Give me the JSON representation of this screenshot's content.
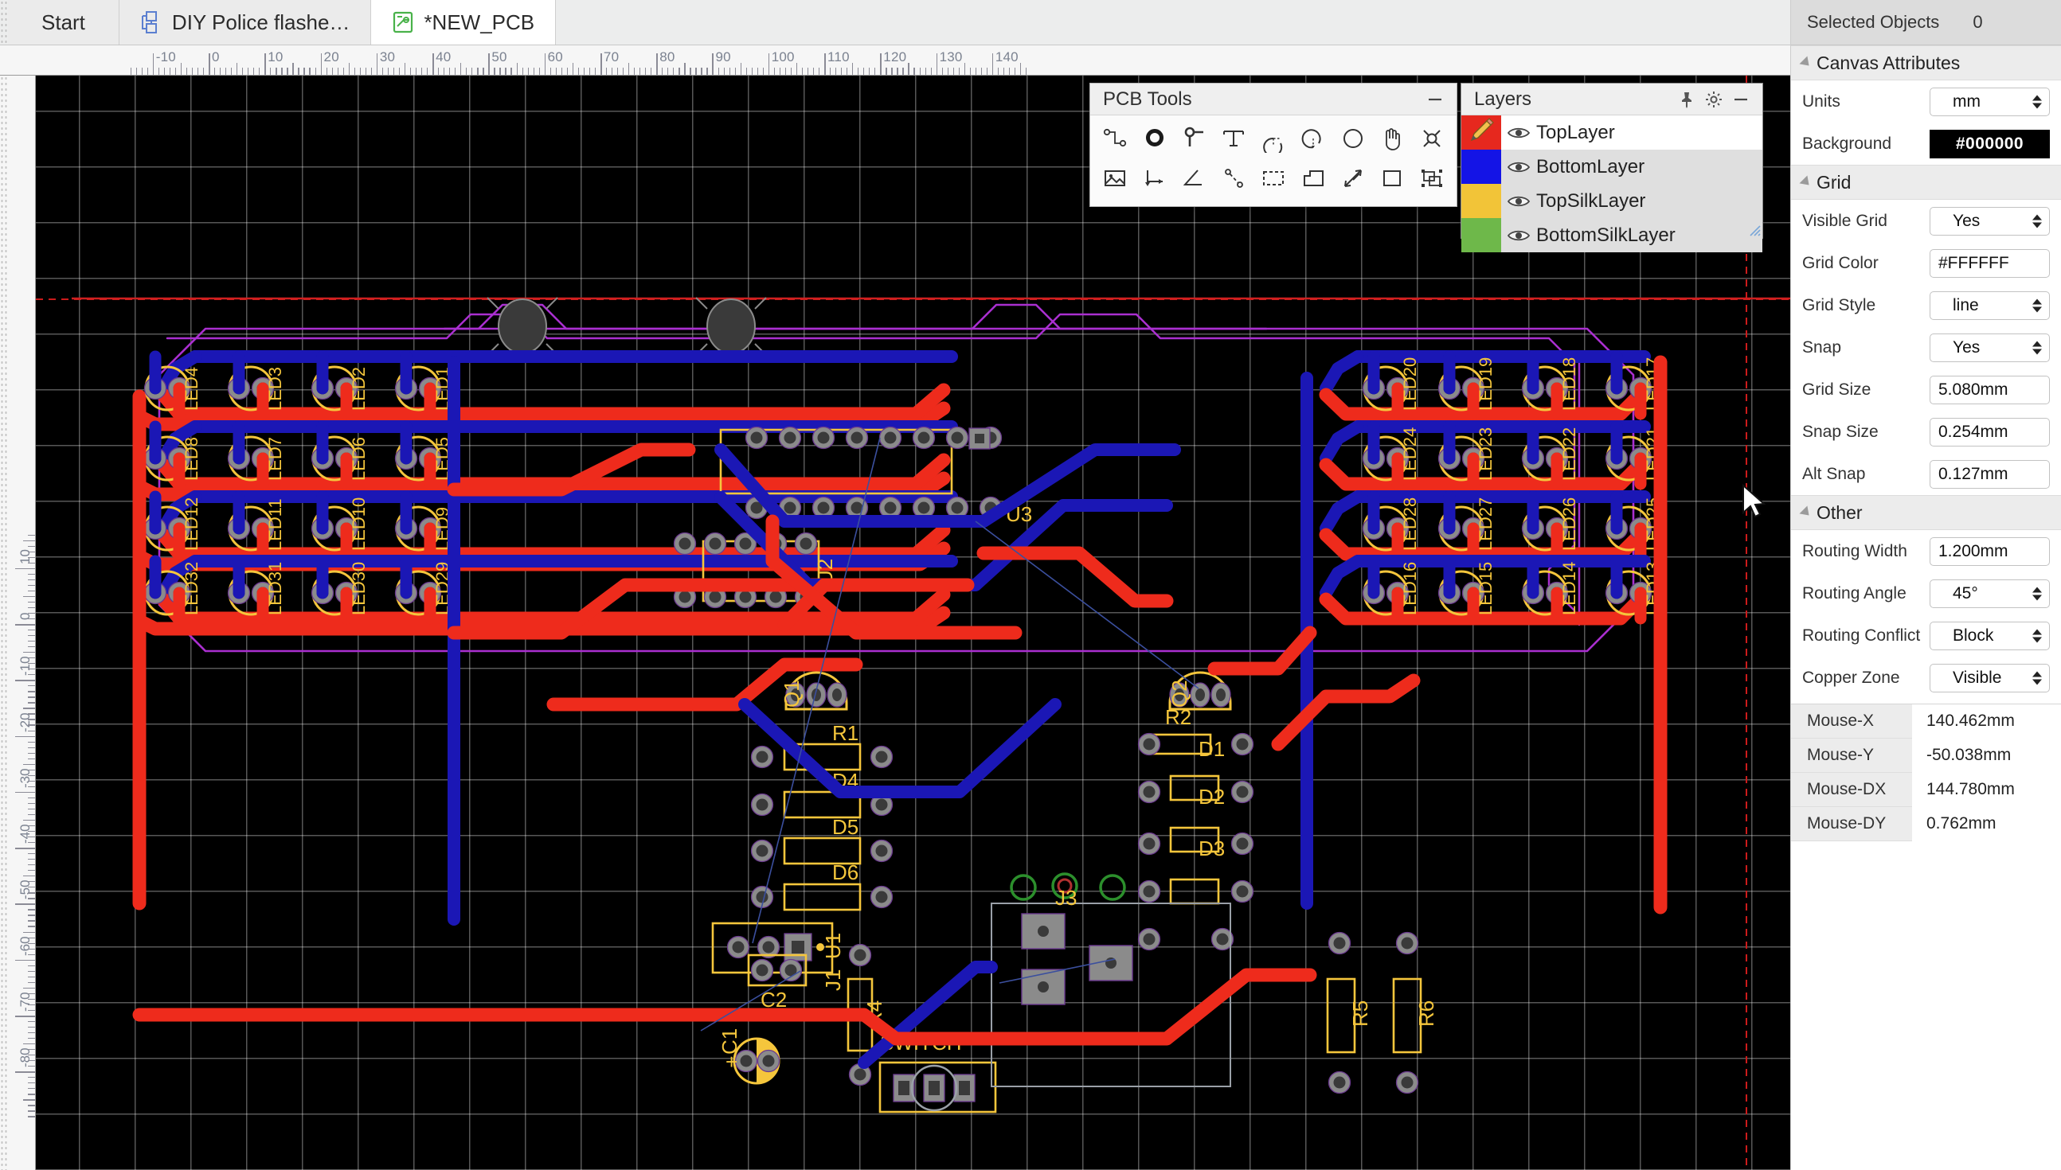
{
  "tabs": [
    {
      "label": "Start",
      "icon": "none",
      "active": false
    },
    {
      "label": "DIY Police flashe…",
      "icon": "schematic-icon",
      "active": false
    },
    {
      "label": "*NEW_PCB",
      "icon": "pcb-icon",
      "active": true
    }
  ],
  "rulers": {
    "units": "mm",
    "horizontal_labels": [
      "-10",
      "0",
      "10",
      "20",
      "30",
      "40",
      "50",
      "60",
      "70",
      "80",
      "90",
      "100",
      "110",
      "120",
      "130",
      "140"
    ],
    "vertical_labels": [
      "-80",
      "-70",
      "-60",
      "-50",
      "-40",
      "-30",
      "-20",
      "-10",
      "0",
      "10"
    ]
  },
  "pcb_tools": {
    "title": "PCB Tools",
    "minimize_label": "—",
    "tools": [
      "track-icon",
      "pad-icon",
      "via-icon",
      "text-icon",
      "arc-3point-icon",
      "arc-center-icon",
      "circle-icon",
      "hand-icon",
      "hole-icon",
      "image-icon",
      "dimension-icon",
      "angle-icon",
      "measure-icon",
      "select-rect-icon",
      "copper-area-icon",
      "resize-icon",
      "rect-icon",
      "group-icon"
    ]
  },
  "layers": {
    "title": "Layers",
    "pin_label": "pin-icon",
    "settings_label": "gear-icon",
    "minimize_label": "—",
    "items": [
      {
        "name": "TopLayer",
        "color": "#e6281e",
        "visible": true,
        "selected": true,
        "edit": true
      },
      {
        "name": "BottomLayer",
        "color": "#1414e6",
        "visible": true,
        "selected": false,
        "edit": false
      },
      {
        "name": "TopSilkLayer",
        "color": "#f2c438",
        "visible": true,
        "selected": false,
        "edit": false
      },
      {
        "name": "BottomSilkLayer",
        "color": "#6eb84a",
        "visible": true,
        "selected": false,
        "edit": false
      }
    ]
  },
  "inspector": {
    "selected_objects_label": "Selected Objects",
    "selected_objects_value": "0",
    "groups": {
      "canvas": "Canvas Attributes",
      "grid": "Grid",
      "other": "Other"
    },
    "canvas_attributes": [
      {
        "label": "Units",
        "value": "mm",
        "type": "select"
      },
      {
        "label": "Background",
        "value": "#000000",
        "type": "color"
      }
    ],
    "grid_attributes": [
      {
        "label": "Visible Grid",
        "value": "Yes",
        "type": "select"
      },
      {
        "label": "Grid Color",
        "value": "#FFFFFF",
        "type": "text"
      },
      {
        "label": "Grid Style",
        "value": "line",
        "type": "select"
      },
      {
        "label": "Snap",
        "value": "Yes",
        "type": "select"
      },
      {
        "label": "Grid Size",
        "value": "5.080mm",
        "type": "text"
      },
      {
        "label": "Snap Size",
        "value": "0.254mm",
        "type": "text"
      },
      {
        "label": "Alt Snap",
        "value": "0.127mm",
        "type": "text"
      }
    ],
    "other_attributes": [
      {
        "label": "Routing Width",
        "value": "1.200mm",
        "type": "text"
      },
      {
        "label": "Routing Angle",
        "value": "45°",
        "type": "select"
      },
      {
        "label": "Routing Conflict",
        "value": "Block",
        "type": "select"
      },
      {
        "label": "Copper Zone",
        "value": "Visible",
        "type": "select"
      }
    ],
    "mouse": [
      {
        "label": "Mouse-X",
        "value": "140.462mm"
      },
      {
        "label": "Mouse-Y",
        "value": "-50.038mm"
      },
      {
        "label": "Mouse-DX",
        "value": "144.780mm"
      },
      {
        "label": "Mouse-DY",
        "value": "0.762mm"
      }
    ]
  },
  "board": {
    "colors": {
      "top_layer": "#ee2b1c",
      "bottom_layer": "#1b17b5",
      "top_silk": "#f5c63c",
      "board_outline": "#aa2fd0",
      "pad_ring": "#8b8b8b",
      "pad_hole": "#3a3a3a",
      "ratline": "#3b4f9e",
      "bottom_silk": "#2c8f2c",
      "background": "#000000",
      "grid": "#FFFFFF"
    },
    "leds_left": [
      [
        "LED4",
        "LED3",
        "LED2",
        "LED1"
      ],
      [
        "LED8",
        "LED7",
        "LED6",
        "LED5"
      ],
      [
        "LED12",
        "LED11",
        "LED10",
        "LED9"
      ],
      [
        "LED32",
        "LED31",
        "LED30",
        "LED29"
      ]
    ],
    "leds_right": [
      [
        "LED20",
        "LED19",
        "LED18",
        "LED17"
      ],
      [
        "LED24",
        "LED23",
        "LED22",
        "LED21"
      ],
      [
        "LED28",
        "LED27",
        "LED26",
        "LED25"
      ],
      [
        "LED16",
        "LED15",
        "LED14",
        "LED13"
      ]
    ],
    "components": [
      "Q1",
      "Q2",
      "R1",
      "R2",
      "R4",
      "R5",
      "R6",
      "D1",
      "D2",
      "D3",
      "D4",
      "D5",
      "D6",
      "C1",
      "C2",
      "U1",
      "U2",
      "U3",
      "J1",
      "J3",
      "SWITCH",
      "+"
    ]
  }
}
